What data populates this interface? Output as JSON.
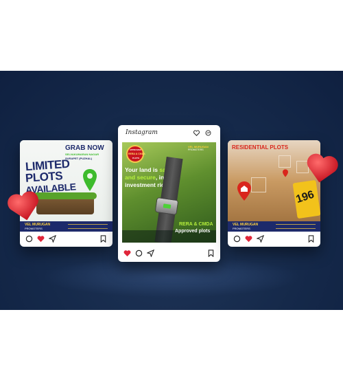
{
  "left_post": {
    "headline": "GRAB NOW",
    "location_line1": "SELVAKUMARAN NAGAR",
    "location_line2": "SURAPET (PUZHAL)",
    "big1": "LIMITED",
    "big2": "PLOTS",
    "big3": "AVAILABLE",
    "brand": "VEL MURUGAN",
    "brand_sub": "PROMOTERS"
  },
  "center_post": {
    "app_title": "Instagram",
    "badge_top": "APPROVED",
    "badge_mid": "RERA & CMDA",
    "badge_bottom": "PLOTS",
    "brand": "VEL MURUGAN",
    "brand_sub": "PROMOTERS",
    "line1_a": "Your land is ",
    "line1_b": "safe",
    "line2_a": "and secure",
    "line2_b": ", in this",
    "line3": "investment ride.",
    "tag1": "RERA & CMDA",
    "tag2": "Approved plots"
  },
  "right_post": {
    "title": "RESIDENTIAL PLOTS",
    "sign_number": "196",
    "brand": "VEL MURUGAN",
    "brand_sub": "PROMOTERS"
  },
  "colors": {
    "background": "#15294a",
    "like": "#e0263a",
    "green": "#3dbb2c",
    "navy": "#1d2a6b"
  }
}
